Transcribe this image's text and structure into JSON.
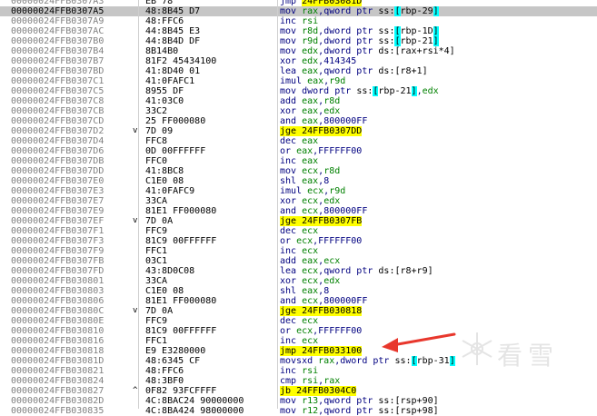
{
  "watermark": {
    "text": "看雪",
    "logo": "snowflake-logo"
  },
  "colors": {
    "selected_row": "#c6c6c6",
    "jump_highlight": "#ffff00",
    "bracket_highlight": "#00ffff",
    "arrow": "#e8372c"
  },
  "rows": [
    {
      "addr": "00000024FFB0307A3",
      "bytes": "EB 78",
      "mark": "",
      "instr": [
        [
          "jmp ",
          "m"
        ],
        [
          "24FFB03081D",
          "jj"
        ]
      ]
    },
    {
      "addr": "00000024FFB0307A5",
      "bytes": "48:8B45 D7",
      "mark": "",
      "selected": true,
      "instr": [
        [
          "mov ",
          "m"
        ],
        [
          "rax",
          "r"
        ],
        [
          ",",
          "p"
        ],
        [
          "qword ptr ",
          "o"
        ],
        [
          "ss:",
          "seg"
        ],
        [
          "[",
          "b"
        ],
        [
          "rbp-29",
          "mem"
        ],
        [
          "]",
          "b"
        ]
      ]
    },
    {
      "addr": "00000024FFB0307A9",
      "bytes": "48:FFC6",
      "mark": "",
      "instr": [
        [
          "inc ",
          "m"
        ],
        [
          "rsi",
          "r"
        ]
      ]
    },
    {
      "addr": "00000024FFB0307AC",
      "bytes": "44:8B45 E3",
      "mark": "",
      "instr": [
        [
          "mov ",
          "m"
        ],
        [
          "r8d",
          "r"
        ],
        [
          ",",
          "p"
        ],
        [
          "dword ptr ",
          "o"
        ],
        [
          "ss:",
          "seg"
        ],
        [
          "[",
          "b"
        ],
        [
          "rbp-1D",
          "mem"
        ],
        [
          "]",
          "b"
        ]
      ]
    },
    {
      "addr": "00000024FFB0307B0",
      "bytes": "44:8B4D DF",
      "mark": "",
      "instr": [
        [
          "mov ",
          "m"
        ],
        [
          "r9d",
          "r"
        ],
        [
          ",",
          "p"
        ],
        [
          "dword ptr ",
          "o"
        ],
        [
          "ss:",
          "seg"
        ],
        [
          "[",
          "b"
        ],
        [
          "rbp-21",
          "mem"
        ],
        [
          "]",
          "b"
        ]
      ]
    },
    {
      "addr": "00000024FFB0307B4",
      "bytes": "8B14B0",
      "mark": "",
      "instr": [
        [
          "mov ",
          "m"
        ],
        [
          "edx",
          "r"
        ],
        [
          ",",
          "p"
        ],
        [
          "dword ptr ",
          "o"
        ],
        [
          "ds:",
          "seg"
        ],
        [
          "[rax+rsi*4]",
          "mem"
        ]
      ]
    },
    {
      "addr": "00000024FFB0307B7",
      "bytes": "81F2 45434100",
      "mark": "",
      "instr": [
        [
          "xor ",
          "m"
        ],
        [
          "edx",
          "r"
        ],
        [
          ",",
          "p"
        ],
        [
          "414345",
          "n"
        ]
      ]
    },
    {
      "addr": "00000024FFB0307BD",
      "bytes": "41:8D40 01",
      "mark": "",
      "instr": [
        [
          "lea ",
          "m"
        ],
        [
          "eax",
          "r"
        ],
        [
          ",",
          "p"
        ],
        [
          "qword ptr ",
          "o"
        ],
        [
          "ds:",
          "seg"
        ],
        [
          "[r8+1]",
          "mem"
        ]
      ]
    },
    {
      "addr": "00000024FFB0307C1",
      "bytes": "41:0FAFC1",
      "mark": "",
      "instr": [
        [
          "imul ",
          "m"
        ],
        [
          "eax",
          "r"
        ],
        [
          ",",
          "p"
        ],
        [
          "r9d",
          "r"
        ]
      ]
    },
    {
      "addr": "00000024FFB0307C5",
      "bytes": "8955 DF",
      "mark": "",
      "instr": [
        [
          "mov ",
          "m"
        ],
        [
          "dword ptr ",
          "o"
        ],
        [
          "ss:",
          "seg"
        ],
        [
          "[",
          "b"
        ],
        [
          "rbp-21",
          "mem"
        ],
        [
          "]",
          "b"
        ],
        [
          ",",
          "p"
        ],
        [
          "edx",
          "r"
        ]
      ]
    },
    {
      "addr": "00000024FFB0307C8",
      "bytes": "41:03C0",
      "mark": "",
      "instr": [
        [
          "add ",
          "m"
        ],
        [
          "eax",
          "r"
        ],
        [
          ",",
          "p"
        ],
        [
          "r8d",
          "r"
        ]
      ]
    },
    {
      "addr": "00000024FFB0307CB",
      "bytes": "33C2",
      "mark": "",
      "instr": [
        [
          "xor ",
          "m"
        ],
        [
          "eax",
          "r"
        ],
        [
          ",",
          "p"
        ],
        [
          "edx",
          "r"
        ]
      ]
    },
    {
      "addr": "00000024FFB0307CD",
      "bytes": "25 FF000080",
      "mark": "",
      "instr": [
        [
          "and ",
          "m"
        ],
        [
          "eax",
          "r"
        ],
        [
          ",",
          "p"
        ],
        [
          "800000FF",
          "n"
        ]
      ]
    },
    {
      "addr": "00000024FFB0307D2",
      "bytes": "7D 09",
      "mark": "v",
      "instr": [
        [
          "jge ",
          "js"
        ],
        [
          "24FFB0307DD",
          "jj"
        ]
      ]
    },
    {
      "addr": "00000024FFB0307D4",
      "bytes": "FFC8",
      "mark": "",
      "instr": [
        [
          "dec ",
          "m"
        ],
        [
          "eax",
          "r"
        ]
      ]
    },
    {
      "addr": "00000024FFB0307D6",
      "bytes": "0D 00FFFFFF",
      "mark": "",
      "instr": [
        [
          "or ",
          "m"
        ],
        [
          "eax",
          "r"
        ],
        [
          ",",
          "p"
        ],
        [
          "FFFFFF00",
          "n"
        ]
      ]
    },
    {
      "addr": "00000024FFB0307DB",
      "bytes": "FFC0",
      "mark": "",
      "instr": [
        [
          "inc ",
          "m"
        ],
        [
          "eax",
          "r"
        ]
      ]
    },
    {
      "addr": "00000024FFB0307DD",
      "bytes": "41:8BC8",
      "mark": "",
      "instr": [
        [
          "mov ",
          "m"
        ],
        [
          "ecx",
          "r"
        ],
        [
          ",",
          "p"
        ],
        [
          "r8d",
          "r"
        ]
      ]
    },
    {
      "addr": "00000024FFB0307E0",
      "bytes": "C1E0 08",
      "mark": "",
      "instr": [
        [
          "shl ",
          "m"
        ],
        [
          "eax",
          "r"
        ],
        [
          ",",
          "p"
        ],
        [
          "8",
          "n"
        ]
      ]
    },
    {
      "addr": "00000024FFB0307E3",
      "bytes": "41:0FAFC9",
      "mark": "",
      "instr": [
        [
          "imul ",
          "m"
        ],
        [
          "ecx",
          "r"
        ],
        [
          ",",
          "p"
        ],
        [
          "r9d",
          "r"
        ]
      ]
    },
    {
      "addr": "00000024FFB0307E7",
      "bytes": "33CA",
      "mark": "",
      "instr": [
        [
          "xor ",
          "m"
        ],
        [
          "ecx",
          "r"
        ],
        [
          ",",
          "p"
        ],
        [
          "edx",
          "r"
        ]
      ]
    },
    {
      "addr": "00000024FFB0307E9",
      "bytes": "81E1 FF000080",
      "mark": "",
      "instr": [
        [
          "and ",
          "m"
        ],
        [
          "ecx",
          "r"
        ],
        [
          ",",
          "p"
        ],
        [
          "800000FF",
          "n"
        ]
      ]
    },
    {
      "addr": "00000024FFB0307EF",
      "bytes": "7D 0A",
      "mark": "v",
      "instr": [
        [
          "jge ",
          "js"
        ],
        [
          "24FFB0307FB",
          "jj"
        ]
      ]
    },
    {
      "addr": "00000024FFB0307F1",
      "bytes": "FFC9",
      "mark": "",
      "instr": [
        [
          "dec ",
          "m"
        ],
        [
          "ecx",
          "r"
        ]
      ]
    },
    {
      "addr": "00000024FFB0307F3",
      "bytes": "81C9 00FFFFFF",
      "mark": "",
      "instr": [
        [
          "or ",
          "m"
        ],
        [
          "ecx",
          "r"
        ],
        [
          ",",
          "p"
        ],
        [
          "FFFFFF00",
          "n"
        ]
      ]
    },
    {
      "addr": "00000024FFB0307F9",
      "bytes": "FFC1",
      "mark": "",
      "instr": [
        [
          "inc ",
          "m"
        ],
        [
          "ecx",
          "r"
        ]
      ]
    },
    {
      "addr": "00000024FFB0307FB",
      "bytes": "03C1",
      "mark": "",
      "instr": [
        [
          "add ",
          "m"
        ],
        [
          "eax",
          "r"
        ],
        [
          ",",
          "p"
        ],
        [
          "ecx",
          "r"
        ]
      ]
    },
    {
      "addr": "00000024FFB0307FD",
      "bytes": "43:8D0C08",
      "mark": "",
      "instr": [
        [
          "lea ",
          "m"
        ],
        [
          "ecx",
          "r"
        ],
        [
          ",",
          "p"
        ],
        [
          "qword ptr ",
          "o"
        ],
        [
          "ds:",
          "seg"
        ],
        [
          "[r8+r9]",
          "mem"
        ]
      ]
    },
    {
      "addr": "00000024FFB030801",
      "bytes": "33CA",
      "mark": "",
      "instr": [
        [
          "xor ",
          "m"
        ],
        [
          "ecx",
          "r"
        ],
        [
          ",",
          "p"
        ],
        [
          "edx",
          "r"
        ]
      ]
    },
    {
      "addr": "00000024FFB030803",
      "bytes": "C1E0 08",
      "mark": "",
      "instr": [
        [
          "shl ",
          "m"
        ],
        [
          "eax",
          "r"
        ],
        [
          ",",
          "p"
        ],
        [
          "8",
          "n"
        ]
      ]
    },
    {
      "addr": "00000024FFB030806",
      "bytes": "81E1 FF000080",
      "mark": "",
      "instr": [
        [
          "and ",
          "m"
        ],
        [
          "ecx",
          "r"
        ],
        [
          ",",
          "p"
        ],
        [
          "800000FF",
          "n"
        ]
      ]
    },
    {
      "addr": "00000024FFB03080C",
      "bytes": "7D 0A",
      "mark": "v",
      "instr": [
        [
          "jge ",
          "js"
        ],
        [
          "24FFB030818",
          "jj"
        ]
      ]
    },
    {
      "addr": "00000024FFB03080E",
      "bytes": "FFC9",
      "mark": "",
      "instr": [
        [
          "dec ",
          "m"
        ],
        [
          "ecx",
          "r"
        ]
      ]
    },
    {
      "addr": "00000024FFB030810",
      "bytes": "81C9 00FFFFFF",
      "mark": "",
      "instr": [
        [
          "or ",
          "m"
        ],
        [
          "ecx",
          "r"
        ],
        [
          ",",
          "p"
        ],
        [
          "FFFFFF00",
          "n"
        ]
      ]
    },
    {
      "addr": "00000024FFB030816",
      "bytes": "FFC1",
      "mark": "",
      "instr": [
        [
          "inc ",
          "m"
        ],
        [
          "ecx",
          "r"
        ]
      ]
    },
    {
      "addr": "00000024FFB030818",
      "bytes": "E9 E3280000",
      "mark": "",
      "instr": [
        [
          "jmp ",
          "js"
        ],
        [
          "24FFB033100",
          "jj"
        ]
      ]
    },
    {
      "addr": "00000024FFB03081D",
      "bytes": "48:6345 CF",
      "mark": "",
      "instr": [
        [
          "movsxd ",
          "m"
        ],
        [
          "rax",
          "r"
        ],
        [
          ",",
          "p"
        ],
        [
          "dword ptr ",
          "o"
        ],
        [
          "ss:",
          "seg"
        ],
        [
          "[",
          "b"
        ],
        [
          "rbp-31",
          "mem"
        ],
        [
          "]",
          "b"
        ]
      ]
    },
    {
      "addr": "00000024FFB030821",
      "bytes": "48:FFC6",
      "mark": "",
      "instr": [
        [
          "inc ",
          "m"
        ],
        [
          "rsi",
          "r"
        ]
      ]
    },
    {
      "addr": "00000024FFB030824",
      "bytes": "48:3BF0",
      "mark": "",
      "instr": [
        [
          "cmp ",
          "m"
        ],
        [
          "rsi",
          "r"
        ],
        [
          ",",
          "p"
        ],
        [
          "rax",
          "r"
        ]
      ]
    },
    {
      "addr": "00000024FFB030827",
      "bytes": "0F82 93FCFFFF",
      "mark": "^",
      "instr": [
        [
          "jb ",
          "js"
        ],
        [
          "24FFB0304C0",
          "jj"
        ]
      ]
    },
    {
      "addr": "00000024FFB03082D",
      "bytes": "4C:8BAC24 90000000",
      "mark": "",
      "instr": [
        [
          "mov ",
          "m"
        ],
        [
          "r13",
          "r"
        ],
        [
          ",",
          "p"
        ],
        [
          "qword ptr ",
          "o"
        ],
        [
          "ss:",
          "seg"
        ],
        [
          "[rsp+90]",
          "mem"
        ]
      ]
    },
    {
      "addr": "00000024FFB030835",
      "bytes": "4C:8BA424 98000000",
      "mark": "",
      "instr": [
        [
          "mov ",
          "m"
        ],
        [
          "r12",
          "r"
        ],
        [
          ",",
          "p"
        ],
        [
          "qword ptr ",
          "o"
        ],
        [
          "ss:",
          "seg"
        ],
        [
          "[rsp+98]",
          "mem"
        ]
      ]
    }
  ]
}
